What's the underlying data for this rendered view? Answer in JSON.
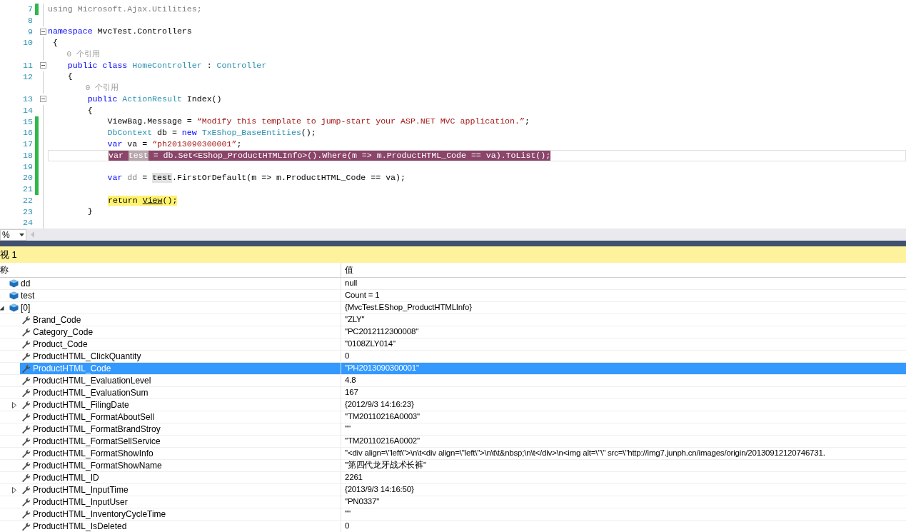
{
  "editor": {
    "lines": [
      {
        "kind": "code",
        "number": "7",
        "changed": true,
        "fold": false,
        "tokens": [
          {
            "text": "using Microsoft.Ajax.Utilities;",
            "kind": "dim"
          }
        ]
      },
      {
        "kind": "code",
        "number": "8",
        "changed": false,
        "fold": false
      },
      {
        "kind": "code",
        "number": "9",
        "changed": false,
        "fold": true,
        "tokens": [
          {
            "text": "namespace",
            "kind": "keyword"
          },
          {
            "text": " MvcTest.Controllers",
            "kind": "plain"
          }
        ]
      },
      {
        "kind": "code",
        "number": "10",
        "changed": false,
        "fold": false,
        "tokens": [
          {
            "text": " {",
            "kind": "plain"
          }
        ]
      },
      {
        "kind": "lens",
        "text": "    0 个引用"
      },
      {
        "kind": "code",
        "number": "11",
        "changed": false,
        "fold": true,
        "tokens": [
          {
            "text": "    public class",
            "kind": "keyword"
          },
          {
            "text": " HomeController",
            "kind": "type"
          },
          {
            "text": " : ",
            "kind": "plain"
          },
          {
            "text": "Controller",
            "kind": "type"
          }
        ]
      },
      {
        "kind": "code",
        "number": "12",
        "changed": false,
        "fold": false,
        "tokens": [
          {
            "text": "    {",
            "kind": "plain"
          }
        ]
      },
      {
        "kind": "lens",
        "text": "        0 个引用"
      },
      {
        "kind": "code",
        "number": "13",
        "changed": false,
        "fold": true,
        "tokens": [
          {
            "text": "        public",
            "kind": "keyword"
          },
          {
            "text": " ActionResult",
            "kind": "type"
          },
          {
            "text": " Index()",
            "kind": "plain"
          }
        ]
      },
      {
        "kind": "code",
        "number": "14",
        "changed": false,
        "fold": false,
        "tokens": [
          {
            "text": "        {",
            "kind": "plain"
          }
        ]
      },
      {
        "kind": "code",
        "number": "15",
        "changed": true,
        "fold": false,
        "tokens": [
          {
            "text": "            ViewBag.Message = ",
            "kind": "plain"
          },
          {
            "text": "“Modify this template to jump-start your ASP.NET MVC application.”",
            "kind": "string"
          },
          {
            "text": ";",
            "kind": "plain"
          }
        ]
      },
      {
        "kind": "code",
        "number": "16",
        "changed": true,
        "fold": false,
        "tokens": [
          {
            "text": "            DbContext",
            "kind": "type"
          },
          {
            "text": " db = ",
            "kind": "plain"
          },
          {
            "text": "new",
            "kind": "keyword"
          },
          {
            "text": " TxEShop_BaseEntities",
            "kind": "type"
          },
          {
            "text": "();",
            "kind": "plain"
          }
        ]
      },
      {
        "kind": "code",
        "number": "17",
        "changed": true,
        "fold": false,
        "tokens": [
          {
            "text": "            var",
            "kind": "keyword"
          },
          {
            "text": " va = ",
            "kind": "plain"
          },
          {
            "text": "“ph2013090300001”",
            "kind": "string"
          },
          {
            "text": ";",
            "kind": "plain"
          }
        ]
      },
      {
        "kind": "code",
        "number": "18",
        "changed": true,
        "fold": false,
        "current": true,
        "tokens": [
          {
            "text": "var ",
            "kind": "selected",
            "indent": true
          },
          {
            "text": "test",
            "kind": "selected-ref"
          },
          {
            "text": " = db.Set<EShop_ProductHTMLInfo>().Where(m => m.ProductHTML_Code == va).ToList();",
            "kind": "selected"
          }
        ]
      },
      {
        "kind": "code",
        "number": "19",
        "changed": true,
        "fold": false
      },
      {
        "kind": "code",
        "number": "20",
        "changed": true,
        "fold": false,
        "tokens": [
          {
            "text": "            var",
            "kind": "keyword"
          },
          {
            "text": " dd",
            "kind": "dim"
          },
          {
            "text": " = ",
            "kind": "plain"
          },
          {
            "text": "test",
            "kind": "ref"
          },
          {
            "text": ".FirstOrDefault(m => m.ProductHTML_Code == va);",
            "kind": "plain"
          }
        ]
      },
      {
        "kind": "code",
        "number": "21",
        "changed": true,
        "fold": false
      },
      {
        "kind": "code",
        "number": "22",
        "changed": false,
        "fold": false,
        "tokens": [
          {
            "text": "return ",
            "kind": "statement",
            "indent": true
          },
          {
            "text": "View",
            "kind": "statement-link"
          },
          {
            "text": "();",
            "kind": "statement"
          }
        ]
      },
      {
        "kind": "code",
        "number": "23",
        "changed": false,
        "fold": false,
        "tokens": [
          {
            "text": "        }",
            "kind": "plain"
          }
        ]
      },
      {
        "kind": "code",
        "number": "24",
        "changed": false,
        "fold": false
      }
    ]
  },
  "zoom": {
    "value": "%"
  },
  "watch": {
    "title": "视 1",
    "columns": [
      "称",
      "值"
    ],
    "rows": [
      {
        "name": "dd",
        "value": "null",
        "kind": "variable",
        "selected": false
      },
      {
        "name": "test",
        "value": "Count = 1",
        "kind": "variable",
        "selected": false
      },
      {
        "name": "[0]",
        "value": "{MvcTest.EShop_ProductHTMLInfo}",
        "kind": "variable",
        "selected": false,
        "expanded": true,
        "children": [
          {
            "name": "Brand_Code",
            "value": "\"ZLY\"",
            "kind": "property",
            "selected": false
          },
          {
            "name": "Category_Code",
            "value": "\"PC2012112300008\"",
            "kind": "property",
            "selected": false
          },
          {
            "name": "Product_Code",
            "value": "\"0108ZLY014\"",
            "kind": "property",
            "selected": false
          },
          {
            "name": "ProductHTML_ClickQuantity",
            "value": "0",
            "kind": "property",
            "selected": false
          },
          {
            "name": "ProductHTML_Code",
            "value": "\"PH2013090300001\"",
            "kind": "property",
            "selected": true
          },
          {
            "name": "ProductHTML_EvaluationLevel",
            "value": "4.8",
            "kind": "property",
            "selected": false
          },
          {
            "name": "ProductHTML_EvaluationSum",
            "value": "167",
            "kind": "property",
            "selected": false
          },
          {
            "name": "ProductHTML_FilingDate",
            "value": "{2012/9/3 14:16:23}",
            "kind": "property",
            "selected": false,
            "expanded": false
          },
          {
            "name": "ProductHTML_FormatAboutSell",
            "value": "\"TM20110216A0003\"",
            "kind": "property",
            "selected": false
          },
          {
            "name": "ProductHTML_FormatBrandStroy",
            "value": "\"\"",
            "kind": "property",
            "selected": false
          },
          {
            "name": "ProductHTML_FormatSellService",
            "value": "\"TM20110216A0002\"",
            "kind": "property",
            "selected": false
          },
          {
            "name": "ProductHTML_FormatShowInfo",
            "value": "\"<div align=\\\"left\\\">\\n\\t<div align=\\\"left\\\">\\n\\t\\t&nbsp;\\n\\t</div>\\n<img alt=\\\"\\\" src=\\\"http://img7.junph.cn/images/origin/20130912120746731.",
            "kind": "property",
            "selected": false
          },
          {
            "name": "ProductHTML_FormatShowName",
            "value": "\"第四代龙牙战术长裤\"",
            "kind": "property",
            "selected": false
          },
          {
            "name": "ProductHTML_ID",
            "value": "2261",
            "kind": "property",
            "selected": false
          },
          {
            "name": "ProductHTML_InputTime",
            "value": "{2013/9/3 14:16:50}",
            "kind": "property",
            "selected": false,
            "expanded": false
          },
          {
            "name": "ProductHTML_InputUser",
            "value": "\"PN0337\"",
            "kind": "property",
            "selected": false
          },
          {
            "name": "ProductHTML_InventoryCycleTime",
            "value": "\"\"",
            "kind": "property",
            "selected": false
          },
          {
            "name": "ProductHTML_IsDeleted",
            "value": "0",
            "kind": "property",
            "selected": false
          }
        ]
      }
    ]
  }
}
